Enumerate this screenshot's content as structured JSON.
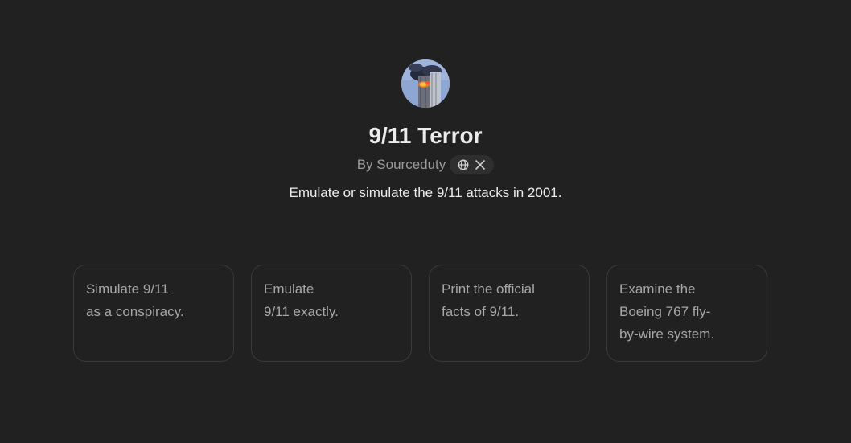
{
  "gpt": {
    "title": "9/11 Terror",
    "byline": "By Sourceduty",
    "description": "Emulate or simulate the 9/11 attacks in 2001.",
    "social_icons": [
      "globe-icon",
      "x-icon"
    ]
  },
  "conversation_starters": [
    {
      "text": "Simulate 9/11\nas a conspiracy."
    },
    {
      "text": "Emulate\n9/11 exactly."
    },
    {
      "text": "Print the official\nfacts of 9/11."
    },
    {
      "text": "Examine the\nBoeing 767 fly-\nby-wire system."
    }
  ],
  "colors": {
    "background": "#212121",
    "text_primary": "#ececec",
    "text_secondary": "#9b9b9b",
    "card_border": "#3a3a3a"
  }
}
